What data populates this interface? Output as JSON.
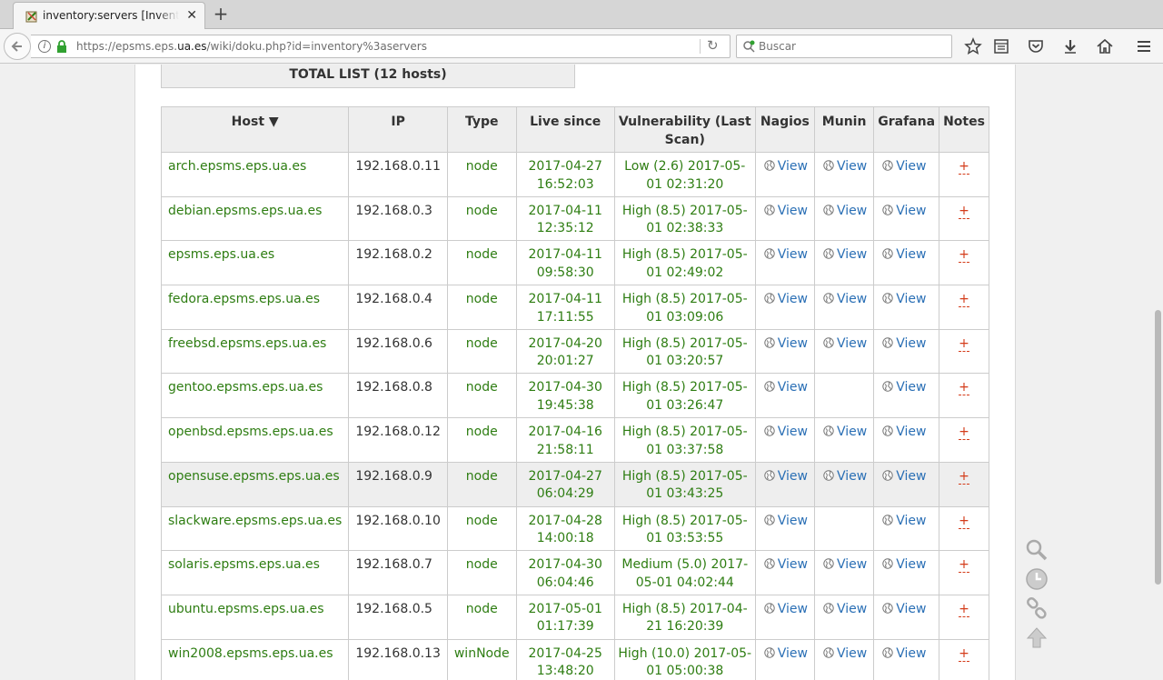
{
  "browser": {
    "tab_title": "inventory:servers [Inventory]",
    "url_prefix": "https://epsms.eps.",
    "url_domain": "ua.es",
    "url_suffix": "/wiki/doku.php?id=inventory%3aservers",
    "search_placeholder": "Buscar"
  },
  "page": {
    "total_label": "TOTAL LIST (12 hosts)",
    "headers": {
      "host": "Host ▼",
      "ip": "IP",
      "type": "Type",
      "live": "Live since",
      "vuln": "Vulnerability (Last Scan)",
      "nagios": "Nagios",
      "munin": "Munin",
      "grafana": "Grafana",
      "notes": "Notes"
    },
    "link_label": "View",
    "notes_label": "+",
    "rows": [
      {
        "host": "arch.epsms.eps.ua.es",
        "ip": "192.168.0.11",
        "type": "node",
        "live": "2017-04-27 16:52:03",
        "vuln": "Low (2.6) 2017-05-01 02:31:20",
        "nagios": true,
        "munin": true,
        "grafana": true
      },
      {
        "host": "debian.epsms.eps.ua.es",
        "ip": "192.168.0.3",
        "type": "node",
        "live": "2017-04-11 12:35:12",
        "vuln": "High (8.5) 2017-05-01 02:38:33",
        "nagios": true,
        "munin": true,
        "grafana": true
      },
      {
        "host": "epsms.eps.ua.es",
        "ip": "192.168.0.2",
        "type": "node",
        "live": "2017-04-11 09:58:30",
        "vuln": "High (8.5) 2017-05-01 02:49:02",
        "nagios": true,
        "munin": true,
        "grafana": true
      },
      {
        "host": "fedora.epsms.eps.ua.es",
        "ip": "192.168.0.4",
        "type": "node",
        "live": "2017-04-11 17:11:55",
        "vuln": "High (8.5) 2017-05-01 03:09:06",
        "nagios": true,
        "munin": true,
        "grafana": true
      },
      {
        "host": "freebsd.epsms.eps.ua.es",
        "ip": "192.168.0.6",
        "type": "node",
        "live": "2017-04-20 20:01:27",
        "vuln": "High (8.5) 2017-05-01 03:20:57",
        "nagios": true,
        "munin": true,
        "grafana": true
      },
      {
        "host": "gentoo.epsms.eps.ua.es",
        "ip": "192.168.0.8",
        "type": "node",
        "live": "2017-04-30 19:45:38",
        "vuln": "High (8.5) 2017-05-01 03:26:47",
        "nagios": true,
        "munin": false,
        "grafana": true
      },
      {
        "host": "openbsd.epsms.eps.ua.es",
        "ip": "192.168.0.12",
        "type": "node",
        "live": "2017-04-16 21:58:11",
        "vuln": "High (8.5) 2017-05-01 03:37:58",
        "nagios": true,
        "munin": true,
        "grafana": true
      },
      {
        "host": "opensuse.epsms.eps.ua.es",
        "ip": "192.168.0.9",
        "type": "node",
        "live": "2017-04-27 06:04:29",
        "vuln": "High (8.5) 2017-05-01 03:43:25",
        "nagios": true,
        "munin": true,
        "grafana": true,
        "highlight": true
      },
      {
        "host": "slackware.epsms.eps.ua.es",
        "ip": "192.168.0.10",
        "type": "node",
        "live": "2017-04-28 14:00:18",
        "vuln": "High (8.5) 2017-05-01 03:53:55",
        "nagios": true,
        "munin": false,
        "grafana": true
      },
      {
        "host": "solaris.epsms.eps.ua.es",
        "ip": "192.168.0.7",
        "type": "node",
        "live": "2017-04-30 06:04:46",
        "vuln": "Medium (5.0) 2017-05-01 04:02:44",
        "nagios": true,
        "munin": true,
        "grafana": true
      },
      {
        "host": "ubuntu.epsms.eps.ua.es",
        "ip": "192.168.0.5",
        "type": "node",
        "live": "2017-05-01 01:17:39",
        "vuln": "High (8.5) 2017-04-21 16:20:39",
        "nagios": true,
        "munin": true,
        "grafana": true
      },
      {
        "host": "win2008.epsms.eps.ua.es",
        "ip": "192.168.0.13",
        "type": "winNode",
        "live": "2017-04-25 13:48:20",
        "vuln": "High (10.0) 2017-05-01 05:00:38",
        "nagios": true,
        "munin": true,
        "grafana": true
      }
    ]
  },
  "colors": {
    "host_green": "#2e7d12",
    "link_blue": "#2a6fb5",
    "notes_red": "#d43c1a",
    "header_bg": "#eeeeee"
  },
  "icons": {
    "tab_favicon": "dokuwiki-icon",
    "side_tools": [
      "search-icon",
      "clock-icon",
      "link-icon",
      "arrow-up-icon"
    ]
  }
}
